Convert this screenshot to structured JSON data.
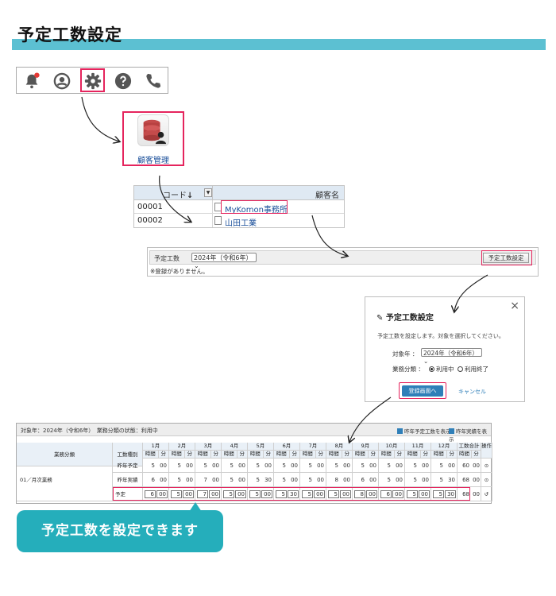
{
  "title": "予定工数設定",
  "colors": {
    "accent": "#5cc0d2",
    "highlight": "#e5245d",
    "link": "#1a4f9a",
    "primary_button": "#2f7fb8",
    "callout": "#25aebb"
  },
  "toolbar": {
    "icons": [
      "bell-icon",
      "user-icon",
      "gear-icon",
      "help-icon",
      "phone-icon"
    ],
    "notification_dot": true
  },
  "app_tile": {
    "label": "顧客管理",
    "icon": "database-user-icon"
  },
  "customer_table": {
    "headers": {
      "code": "コード",
      "sort_indicator": "↓",
      "name": "顧客名"
    },
    "rows": [
      {
        "code": "00001",
        "name": "MyKomon事務所"
      },
      {
        "code": "00002",
        "name": "山田工業"
      }
    ]
  },
  "plan_panel": {
    "label": "予定工数",
    "year": "2024年（令和6年）",
    "button": "予定工数設定",
    "note": "※登録がありません。"
  },
  "dialog": {
    "title": "予定工数設定",
    "description": "予定工数を設定します。対象を選択してください。",
    "year_label": "対象年 ：",
    "year_value": "2024年（令和6年）",
    "category_label": "業務分類 ：",
    "options": [
      {
        "label": "利用中",
        "selected": true
      },
      {
        "label": "利用終了",
        "selected": false
      }
    ],
    "register_button": "登録画面へ",
    "cancel": "キャンセル",
    "close": "×"
  },
  "work_table": {
    "status": "対象年：2024年（令和6年）　業務分類の状態：利用中",
    "checkbox_1": "昨年予定工数を表示",
    "checkbox_2": "昨年実績を表示",
    "col_category": "業務分類",
    "col_type": "工数種別",
    "months": [
      "1月",
      "2月",
      "3月",
      "4月",
      "5月",
      "6月",
      "7月",
      "8月",
      "9月",
      "10月",
      "11月",
      "12月"
    ],
    "total": "工数合計",
    "action": "操作",
    "sub_hour": "時間",
    "sub_min": "分",
    "category_name": "01／月次業務",
    "rows": [
      {
        "type": "昨年予定",
        "values": [
          [
            "5",
            "00"
          ],
          [
            "5",
            "00"
          ],
          [
            "5",
            "00"
          ],
          [
            "5",
            "00"
          ],
          [
            "5",
            "00"
          ],
          [
            "5",
            "00"
          ],
          [
            "5",
            "00"
          ],
          [
            "5",
            "00"
          ],
          [
            "5",
            "00"
          ],
          [
            "5",
            "00"
          ],
          [
            "5",
            "00"
          ],
          [
            "5",
            "00"
          ]
        ],
        "total": [
          "60",
          "00"
        ]
      },
      {
        "type": "昨年実績",
        "values": [
          [
            "6",
            "00"
          ],
          [
            "5",
            "00"
          ],
          [
            "7",
            "00"
          ],
          [
            "5",
            "00"
          ],
          [
            "5",
            "30"
          ],
          [
            "5",
            "00"
          ],
          [
            "5",
            "00"
          ],
          [
            "8",
            "00"
          ],
          [
            "6",
            "00"
          ],
          [
            "5",
            "00"
          ],
          [
            "5",
            "00"
          ],
          [
            "5",
            "30"
          ]
        ],
        "total": [
          "68",
          "00"
        ]
      },
      {
        "type": "予定",
        "values": [
          [
            "6",
            "00"
          ],
          [
            "5",
            "00"
          ],
          [
            "7",
            "00"
          ],
          [
            "5",
            "00"
          ],
          [
            "5",
            "00"
          ],
          [
            "5",
            "30"
          ],
          [
            "5",
            "00"
          ],
          [
            "5",
            "00"
          ],
          [
            "8",
            "00"
          ],
          [
            "6",
            "00"
          ],
          [
            "5",
            "00"
          ],
          [
            "5",
            "30"
          ]
        ],
        "total": [
          "68",
          "00"
        ]
      }
    ]
  },
  "callout": "予定工数を設定できます"
}
